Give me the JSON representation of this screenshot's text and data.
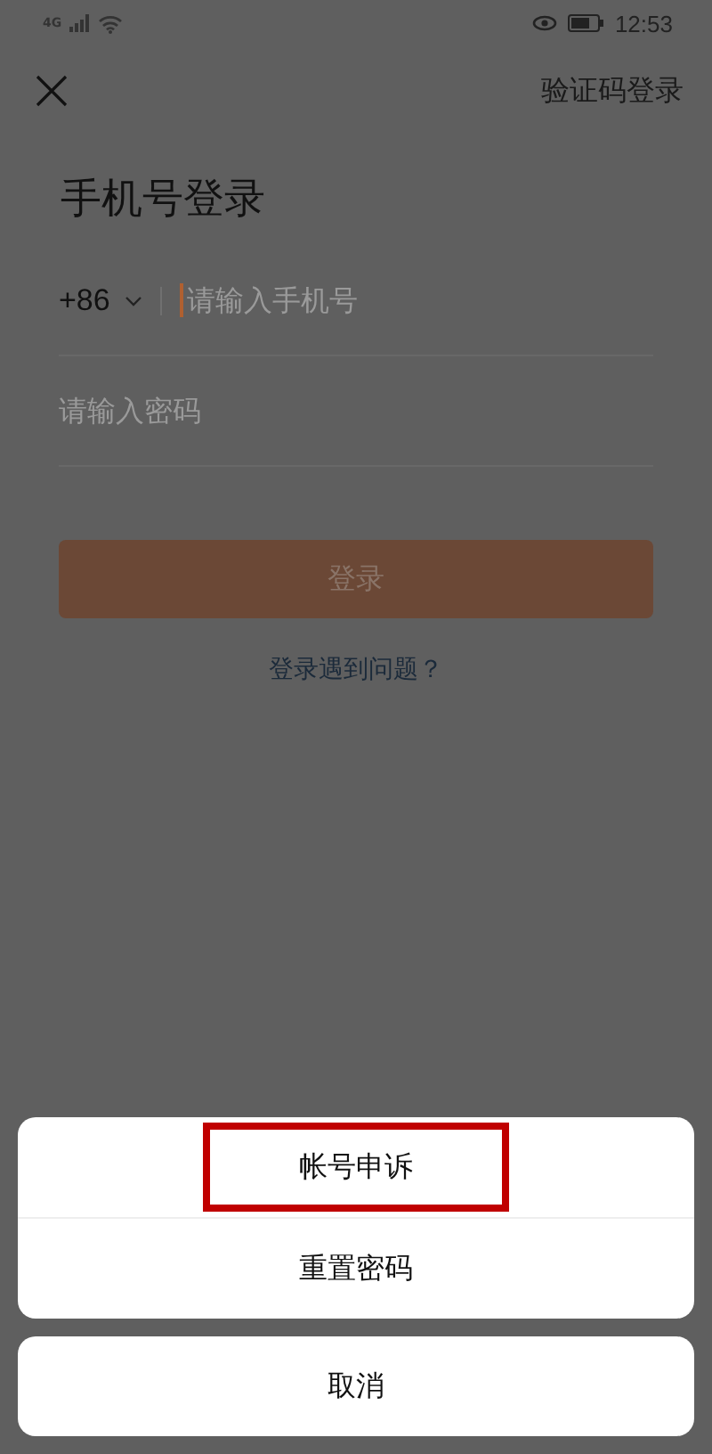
{
  "status_bar": {
    "network": "4G",
    "time": "12:53"
  },
  "header": {
    "switch_link": "验证码登录"
  },
  "title": "手机号登录",
  "phone_field": {
    "country_code": "+86",
    "placeholder": "请输入手机号"
  },
  "password_field": {
    "placeholder": "请输入密码"
  },
  "login_button": {
    "label": "登录",
    "disabled": true
  },
  "help_link": "登录遇到问题？",
  "action_sheet": {
    "items": [
      {
        "label": "帐号申诉",
        "highlighted": true
      },
      {
        "label": "重置密码",
        "highlighted": false
      }
    ],
    "cancel": "取消"
  }
}
